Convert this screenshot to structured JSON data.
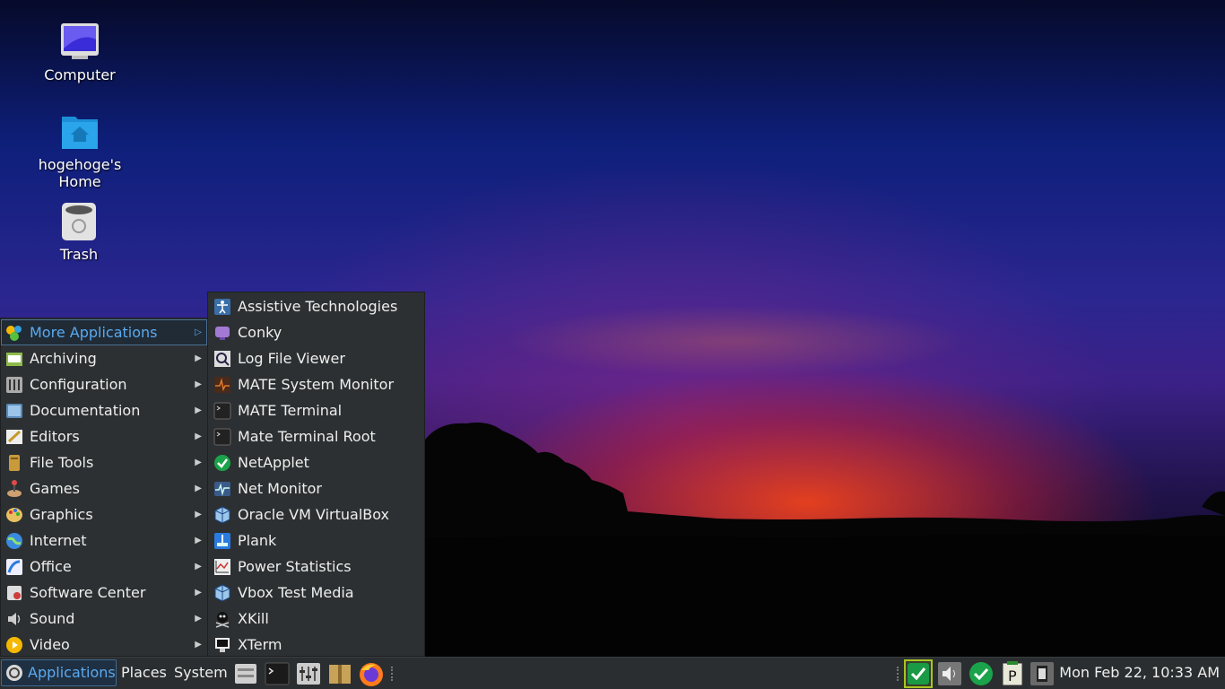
{
  "desktop": {
    "icons": [
      {
        "label": "Computer",
        "icon": "computer-icon"
      },
      {
        "label": "hogehoge's\nHome",
        "icon": "home-folder-icon"
      },
      {
        "label": "Trash",
        "icon": "trash-icon"
      }
    ]
  },
  "apps_menu": {
    "items": [
      {
        "label": "More Applications",
        "icon": "more-applications-icon"
      },
      {
        "label": "Archiving",
        "icon": "archiving-icon"
      },
      {
        "label": "Configuration",
        "icon": "configuration-icon"
      },
      {
        "label": "Documentation",
        "icon": "documentation-icon"
      },
      {
        "label": "Editors",
        "icon": "editors-icon"
      },
      {
        "label": "File Tools",
        "icon": "file-tools-icon"
      },
      {
        "label": "Games",
        "icon": "games-icon"
      },
      {
        "label": "Graphics",
        "icon": "graphics-icon"
      },
      {
        "label": "Internet",
        "icon": "internet-icon"
      },
      {
        "label": "Office",
        "icon": "office-icon"
      },
      {
        "label": "Software Center",
        "icon": "software-center-icon"
      },
      {
        "label": "Sound",
        "icon": "sound-icon"
      },
      {
        "label": "Video",
        "icon": "video-icon"
      }
    ]
  },
  "submenu": {
    "items": [
      {
        "label": "Assistive Technologies",
        "icon": "accessibility-icon"
      },
      {
        "label": "Conky",
        "icon": "conky-icon"
      },
      {
        "label": "Log File Viewer",
        "icon": "log-viewer-icon"
      },
      {
        "label": "MATE System Monitor",
        "icon": "system-monitor-icon"
      },
      {
        "label": "MATE Terminal",
        "icon": "terminal-icon"
      },
      {
        "label": "Mate Terminal Root",
        "icon": "terminal-root-icon"
      },
      {
        "label": "NetApplet",
        "icon": "netapplet-icon"
      },
      {
        "label": "Net Monitor",
        "icon": "net-monitor-icon"
      },
      {
        "label": "Oracle VM VirtualBox",
        "icon": "virtualbox-icon"
      },
      {
        "label": "Plank",
        "icon": "plank-icon"
      },
      {
        "label": "Power Statistics",
        "icon": "power-statistics-icon"
      },
      {
        "label": "Vbox Test Media",
        "icon": "vbox-test-media-icon"
      },
      {
        "label": "XKill",
        "icon": "xkill-icon"
      },
      {
        "label": "XTerm",
        "icon": "xterm-icon"
      }
    ]
  },
  "taskbar": {
    "applications": "Applications",
    "places": "Places",
    "system": "System",
    "clock": "Mon Feb 22, 10:33 AM"
  }
}
